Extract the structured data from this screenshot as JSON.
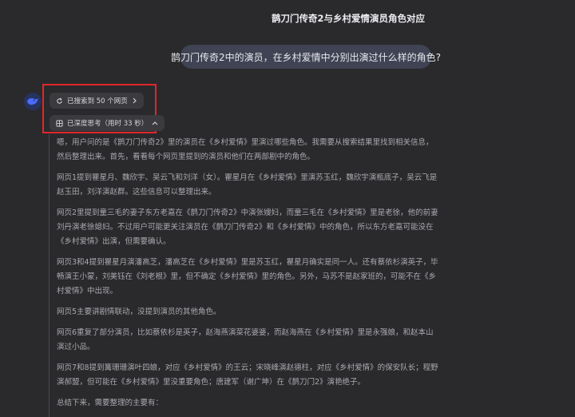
{
  "conversation": {
    "title": "鹊刀门传奇2与乡村爱情演员角色对应"
  },
  "user_message": {
    "text": "鹊刀门传奇2中的演员，在乡村爱情中分别出演过什么样的角色?"
  },
  "assistant": {
    "avatar_icon": "deepseek-whale-icon",
    "search_chip": {
      "label": "已搜索到 50 个网页",
      "icon": "search-refresh-icon",
      "chevron": "chevron-right-icon"
    },
    "thinking_chip": {
      "label": "已深度思考（用时 33 秒）",
      "icon": "think-grid-icon",
      "chevron": "chevron-up-icon"
    },
    "highlight_color": "#e0262c",
    "thinking_paragraphs": [
      "嗯，用户问的是《鹊刀门传奇2》里的演员在《乡村爱情》里演过哪些角色。我需要从搜索结果里找到相关信息，然后整理出来。首先，看看每个网页里提到的演员和他们在两部剧中的角色。",
      "网页1提到瞿星月、魏欣宇、吴云飞和刘洋（女）。瞿星月在《乡村爱情》里演苏玉红，魏欣宇演瓶底子，吴云飞是赵玉田，刘洋演赵群。这些信息可以整理出来。",
      "网页2里提到童三毛的妻子东方老嘉在《鹊刀门传奇2》中演张嫂妇，而童三毛在《乡村爱情》里是老徐，他的前妻刘丹演老徐媳妇。不过用户可能更关注演员在《鹊刀门传奇2》和《乡村爱情》中的角色，所以东方老嘉可能没在《乡村爱情》出演，但需要确认。",
      "网页3和4提到瞿星月演潘高芝，潘高芝在《乡村爱情》里是苏玉红，瞿星月确实是同一人。还有蔡依杉演英子，毕畅演王小蒙，刘美钰在《刘老根》里，但不确定《乡村爱情》里的角色。另外，马苏不是赵家班的，可能不在《乡村爱情》中出现。",
      "网页5主要讲剧情联动，没提到演员的其他角色。",
      "网页6重复了部分演员，比如蔡依杉是英子，赵海燕演菜花婆婆，而赵海燕在《乡村爱情》里是永强娘，和赵本山演过小品。",
      "网页7和8提到篝珊珊演叶四娘，对应《乡村爱情》的王云；宋晓峰演赵德柱，对应《乡村爱情》的保安队长；程野演郝盟，但可能在《乡村爱情》里没重要角色；唐建军（谢广坤）在《鹊刀门2》演艳绝子。",
      "总结下来，需要整理的主要有："
    ]
  }
}
